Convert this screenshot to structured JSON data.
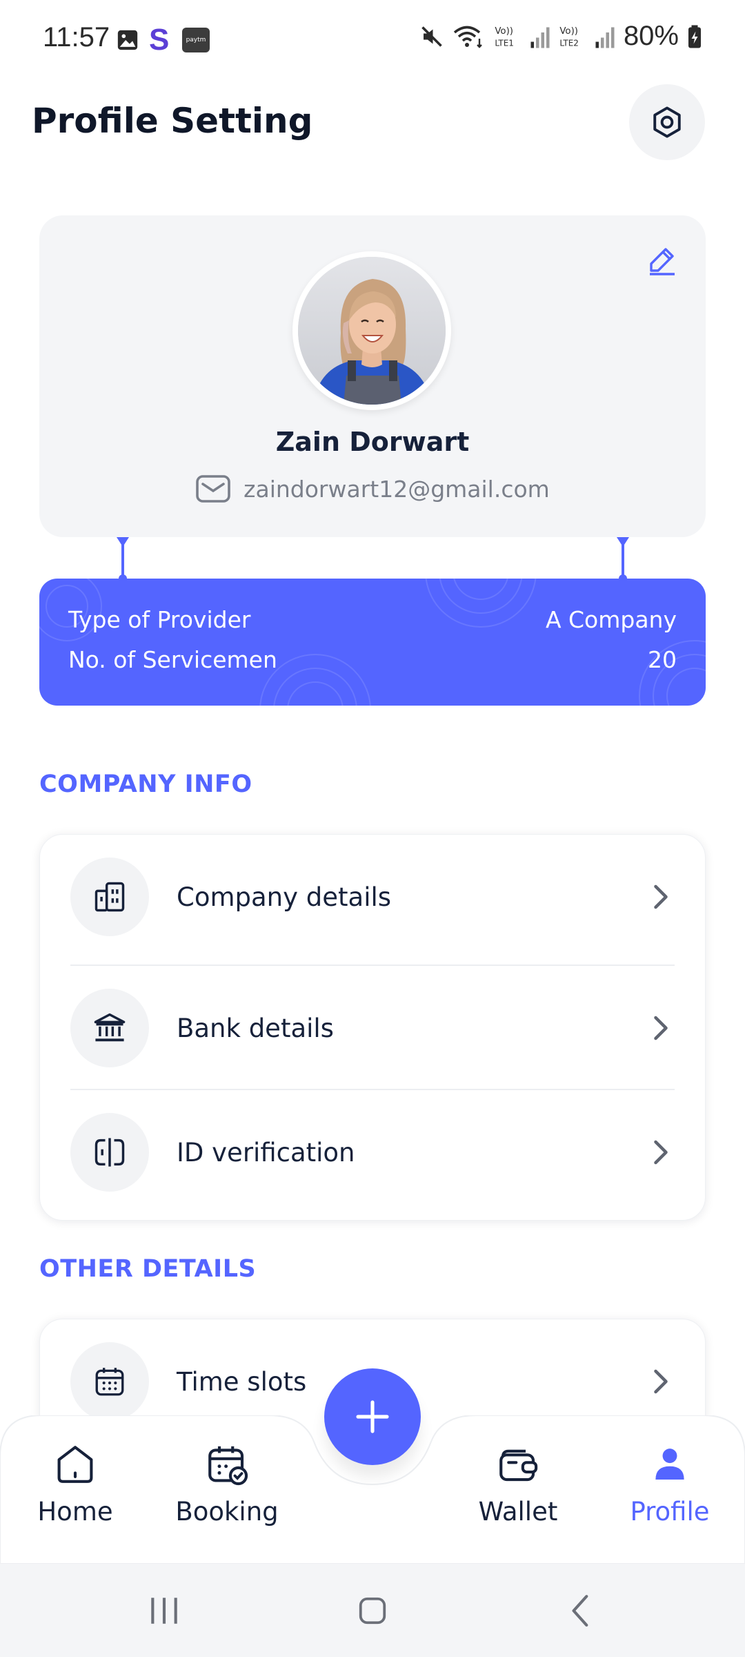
{
  "status_bar": {
    "time": "11:57",
    "battery": "80%",
    "icons": [
      "gallery-icon",
      "s-app-icon",
      "paytm-icon",
      "mute-icon",
      "wifi-icon",
      "volte-lte1-icon",
      "signal-icon",
      "volte-lte2-icon",
      "signal-icon",
      "battery-charging-icon"
    ]
  },
  "header": {
    "title": "Profile Setting",
    "settings_icon": "gear-icon"
  },
  "profile": {
    "name": "Zain Dorwart",
    "email": "zaindorwart12@gmail.com",
    "edit_icon": "pencil-icon"
  },
  "provider": {
    "type_label": "Type of Provider",
    "type_value": "A Company",
    "servicemen_label": "No. of Servicemen",
    "servicemen_value": "20"
  },
  "company_info": {
    "heading": "COMPANY INFO",
    "items": [
      {
        "label": "Company details",
        "icon": "buildings-icon"
      },
      {
        "label": "Bank details",
        "icon": "bank-icon"
      },
      {
        "label": "ID verification",
        "icon": "id-card-icon"
      }
    ]
  },
  "other_details": {
    "heading": "OTHER DETAILS",
    "items": [
      {
        "label": "Time slots",
        "icon": "calendar-icon"
      }
    ]
  },
  "bottom_nav": {
    "items": [
      {
        "label": "Home",
        "icon": "home-icon"
      },
      {
        "label": "Booking",
        "icon": "calendar-check-icon"
      },
      {
        "label": "Wallet",
        "icon": "wallet-icon"
      },
      {
        "label": "Profile",
        "icon": "user-icon"
      }
    ],
    "active": "Profile",
    "fab_icon": "plus-icon"
  },
  "colors": {
    "accent": "#5465ff",
    "title": "#0f1729",
    "card_bg": "#f4f5f7"
  }
}
